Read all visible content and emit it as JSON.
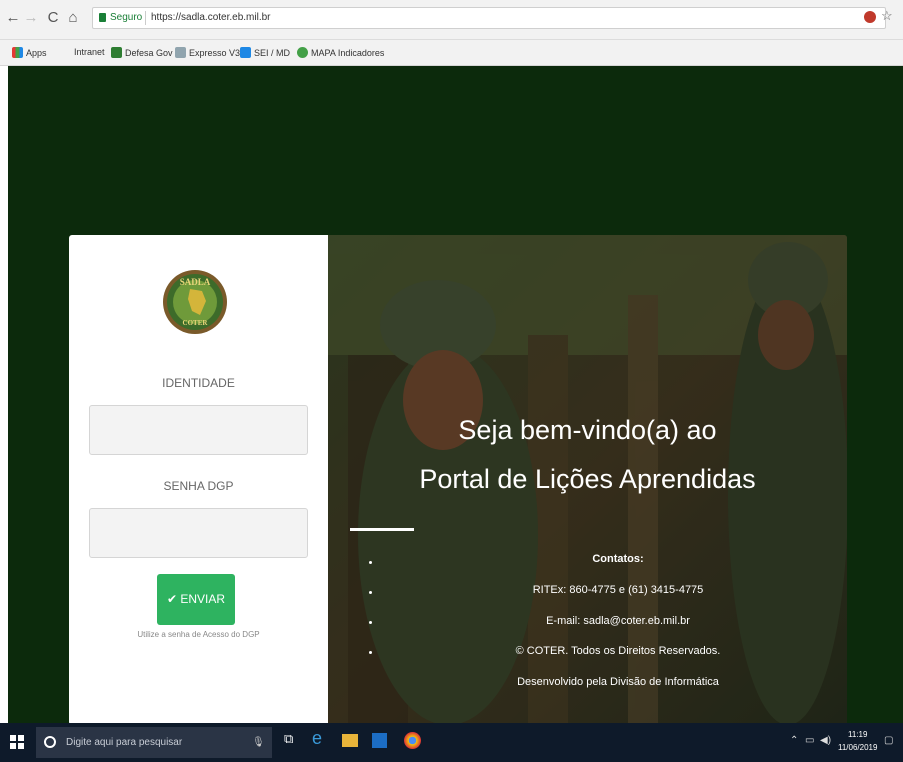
{
  "browser": {
    "security_label": "Seguro",
    "url": "https://sadla.coter.eb.mil.br",
    "bookmarks": [
      "Apps",
      "Intranet",
      "Defesa Gov",
      "Expresso V3",
      "SEI / MD",
      "MAPA Indicadores"
    ]
  },
  "login": {
    "logo_text_top": "SADLA",
    "logo_text_bottom": "COTER",
    "identity_label": "IDENTIDADE",
    "identity_value": "",
    "password_label": "SENHA DGP",
    "password_value": "",
    "submit_label": "ENVIAR",
    "hint": "Utilize a senha de Acesso do DGP"
  },
  "hero": {
    "title_line1": "Seja bem-vindo(a) ao",
    "title_line2": "Portal de Lições Aprendidas",
    "contact_heading": "Contatos:",
    "contact_phone": "RITEx: 860-4775 e (61) 3415-4775",
    "contact_email": "E-mail: sadla@coter.eb.mil.br",
    "copyright": "© COTER. Todos os Direitos Reservados.",
    "developer": "Desenvolvido pela Divisão de Informática"
  },
  "taskbar": {
    "search_placeholder": "Digite aqui para pesquisar",
    "time": "11:19",
    "date": "11/06/2019"
  },
  "colors": {
    "page_background": "#0c2a0c",
    "button": "#2eb360",
    "panel": "#ffffff"
  }
}
